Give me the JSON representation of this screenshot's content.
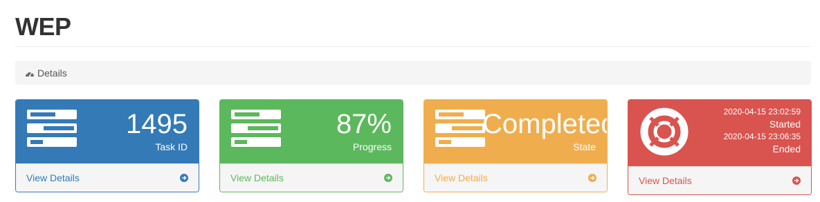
{
  "page": {
    "title": "WEP"
  },
  "breadcrumb": {
    "icon": "dashboard-icon",
    "label": "Details"
  },
  "panels": {
    "task": {
      "value": "1495",
      "label": "Task ID",
      "footer": "View Details",
      "color": "#337ab7",
      "icon": "tasks-icon"
    },
    "progress": {
      "value": "87%",
      "label": "Progress",
      "footer": "View Details",
      "color": "#5cb85c",
      "icon": "tasks-icon"
    },
    "state": {
      "value": "Completed",
      "label": "State",
      "footer": "View Details",
      "color": "#f0ad4e",
      "icon": "tasks-icon"
    },
    "time": {
      "started_at": "2020-04-15 23:02:59",
      "started_label": "Started",
      "ended_at": "2020-04-15 23:06:35",
      "ended_label": "Ended",
      "footer": "View Details",
      "color": "#d9534f",
      "icon": "lifebuoy-icon"
    }
  }
}
